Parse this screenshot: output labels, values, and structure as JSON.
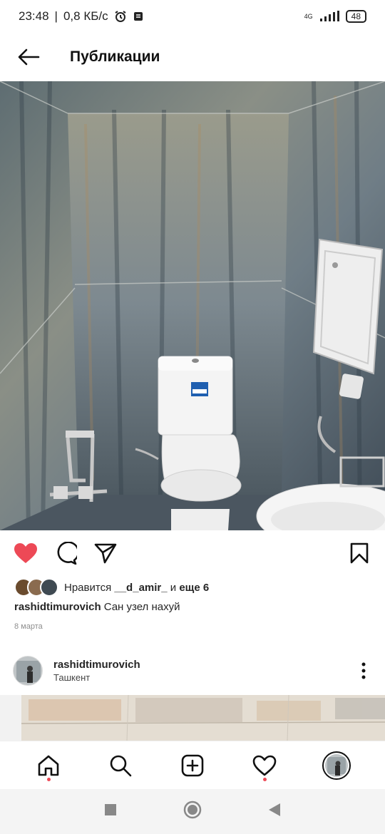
{
  "status_bar": {
    "time": "23:48",
    "net_speed": "0,8 КБ/с",
    "network": "4G",
    "battery": "48"
  },
  "app_bar": {
    "title": "Публикации"
  },
  "post": {
    "liked": true,
    "likes_prefix": "Нравится",
    "liked_by": "__d_amir_",
    "likes_conj": "и",
    "likes_more": "еще 6",
    "author": "rashidtimurovich",
    "caption": "Сан узел нахуй",
    "date": "8 марта"
  },
  "next_post": {
    "author": "rashidtimurovich",
    "location": "Ташкент"
  },
  "colors": {
    "like_red": "#ed4956",
    "notification_dot": "#ed4956"
  },
  "icons": {
    "back": "arrow-left-icon",
    "like": "heart-icon",
    "comment": "comment-icon",
    "share": "send-icon",
    "save": "bookmark-icon",
    "more": "more-vertical-icon",
    "home": "home-icon",
    "search": "search-icon",
    "new_post": "plus-square-icon",
    "activity": "heart-outline-icon",
    "system_recent": "square-icon",
    "system_home": "circle-icon",
    "system_back": "triangle-back-icon"
  }
}
